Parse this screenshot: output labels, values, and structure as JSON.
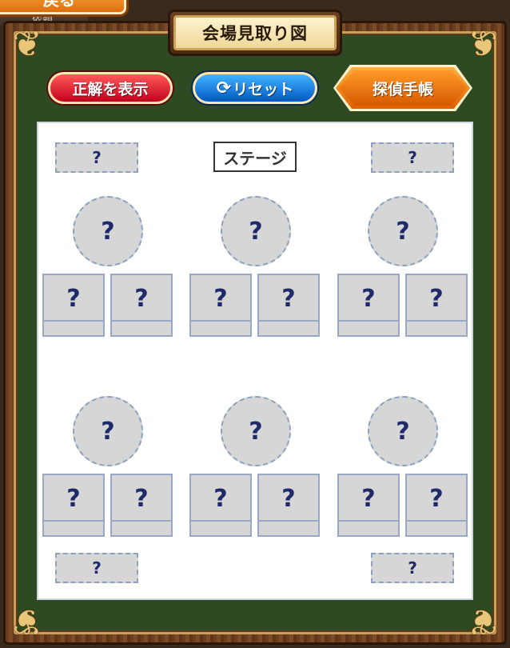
{
  "header": {
    "back_label": "戻る",
    "back_strip_label": "依頼"
  },
  "title": "会場見取り図",
  "buttons": {
    "show_answer": "正解を表示",
    "reset": "リセット",
    "notebook": "探偵手帳"
  },
  "map": {
    "stage_label": "ステージ",
    "unknown_mark": "?"
  },
  "colors": {
    "frame_wood": "#6a3f20",
    "felt_green": "#2e4a22",
    "answer_red": "#c3001e",
    "reset_blue": "#0058c4",
    "notebook_orange": "#e06000",
    "placeholder_gray": "#d6d6d6",
    "mark_navy": "#1f2a6a"
  },
  "icons": {
    "reset": "reset-icon",
    "corner": "ornament-corner-icon"
  }
}
